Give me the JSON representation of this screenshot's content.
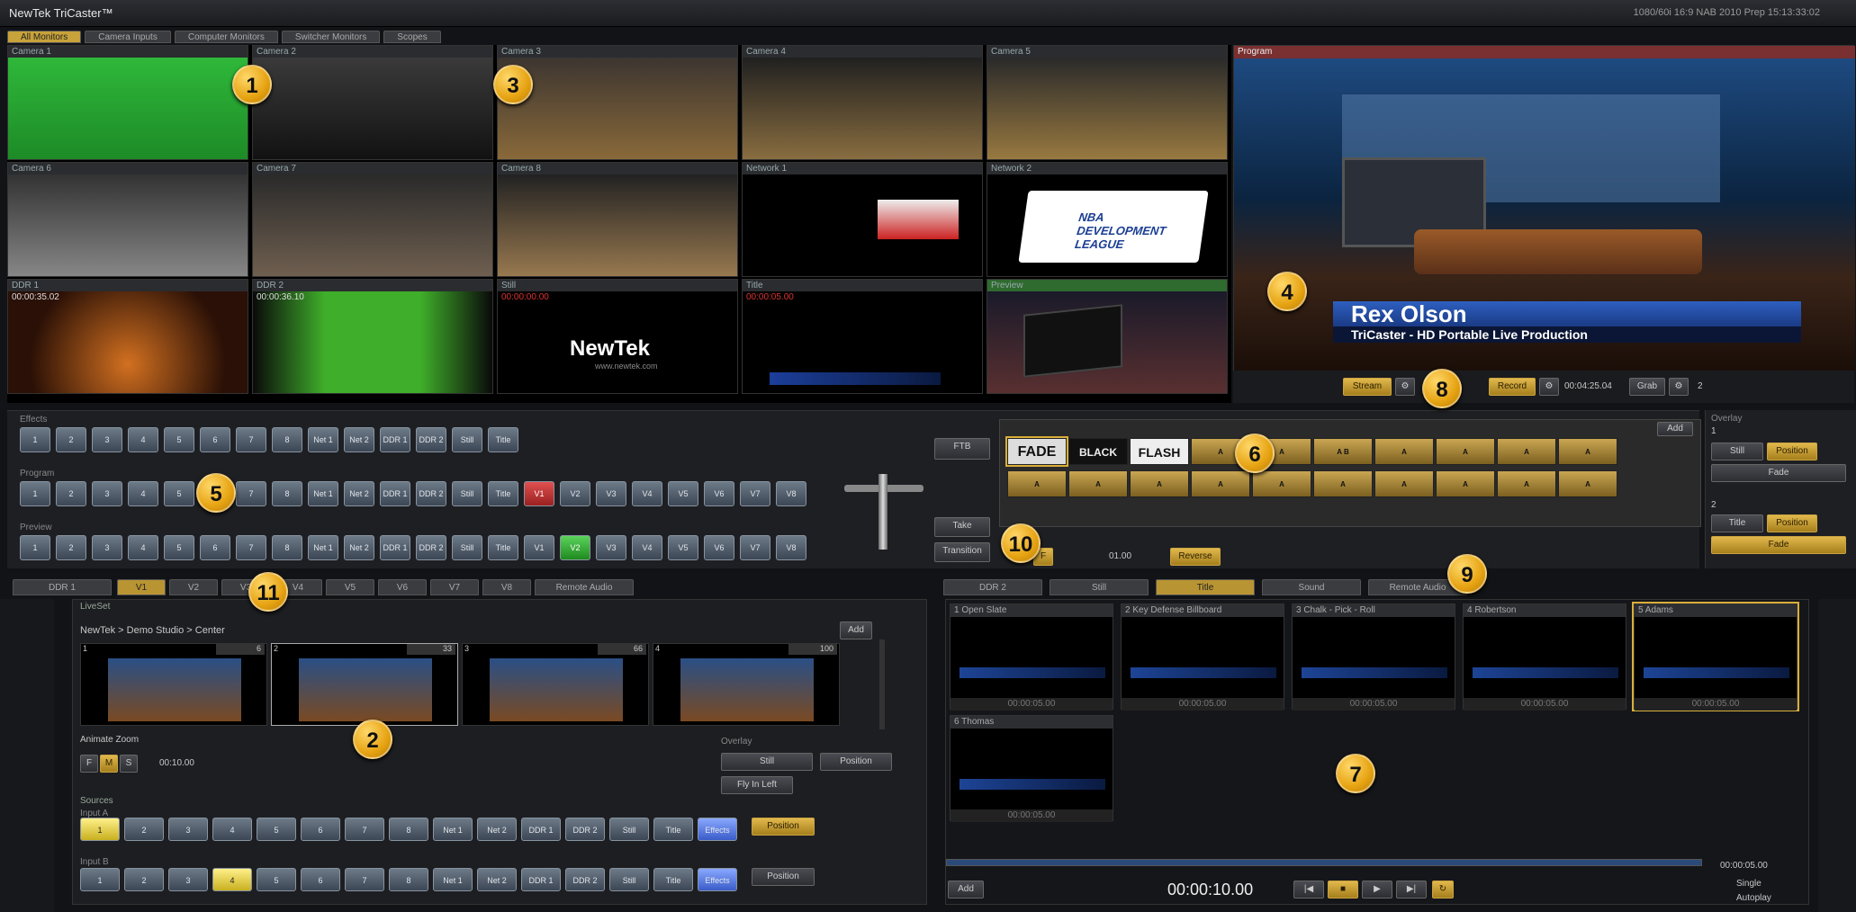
{
  "app": {
    "title": "NewTek TriCaster™",
    "status": "1080/60i 16:9   NAB 2010 Prep   15:13:33:02"
  },
  "monitor_tabs": [
    {
      "label": "All Monitors"
    },
    {
      "label": "Camera Inputs"
    },
    {
      "label": "Computer Monitors"
    },
    {
      "label": "Switcher Monitors"
    },
    {
      "label": "Scopes"
    }
  ],
  "monitors": [
    {
      "label": "Camera 1"
    },
    {
      "label": "Camera 2"
    },
    {
      "label": "Camera 3"
    },
    {
      "label": "Camera 4"
    },
    {
      "label": "Camera 5"
    },
    {
      "label": "Camera 6"
    },
    {
      "label": "Camera 7"
    },
    {
      "label": "Camera 8"
    },
    {
      "label": "Network 1"
    },
    {
      "label": "Network 2"
    },
    {
      "label": "DDR 1",
      "time": "00:00:35.02"
    },
    {
      "label": "DDR 2",
      "time": "00:00:36.10"
    },
    {
      "label": "Still",
      "time": "00:00:00.00"
    },
    {
      "label": "Title",
      "time": "00:00:05.00"
    },
    {
      "label": "Preview"
    }
  ],
  "newtek_logo": "NewTek",
  "newtek_url": "www.newtek.com",
  "nba_text": "NBA DEVELOPMENT LEAGUE",
  "program": {
    "label": "Program",
    "name": "Rex Olson",
    "subtitle": "TriCaster - HD Portable Live Production"
  },
  "record_bar": {
    "stream": "Stream",
    "record": "Record",
    "record_time": "00:04:25.04",
    "grab": "Grab",
    "grab_count": "2"
  },
  "callouts": [
    "1",
    "2",
    "3",
    "4",
    "5",
    "6",
    "7",
    "8",
    "9",
    "10",
    "11"
  ],
  "switcher": {
    "effects_label": "Effects",
    "program_label": "Program",
    "preview_label": "Preview",
    "buttons": [
      "1",
      "2",
      "3",
      "4",
      "5",
      "6",
      "7",
      "8",
      "Net 1",
      "Net 2",
      "DDR 1",
      "DDR 2",
      "Still",
      "Title"
    ],
    "v_buttons": [
      "V1",
      "V2",
      "V3",
      "V4",
      "V5",
      "V6",
      "V7",
      "V8"
    ],
    "ftb": "FTB",
    "take": "Take",
    "transition": "Transition",
    "rate": "01.00",
    "reverse": "Reverse",
    "speed_f": "F"
  },
  "transitions": {
    "add": "Add",
    "tiles": [
      "FADE",
      "BLACK",
      "FLASH",
      "A",
      "A",
      "A B",
      "A",
      "A",
      "A",
      "A",
      "A",
      "A",
      "A",
      "A",
      "A",
      "A",
      "A",
      "A",
      "A",
      "A"
    ]
  },
  "overlay_right": {
    "title": "Overlay",
    "slot1": "1",
    "slot2": "2",
    "still": "Still",
    "title_opt": "Title",
    "position": "Position",
    "fade": "Fade"
  },
  "bottom_tabs": [
    {
      "label": "DDR 1"
    },
    {
      "label": "V1"
    },
    {
      "label": "V2"
    },
    {
      "label": "V3"
    },
    {
      "label": "V4"
    },
    {
      "label": "V5"
    },
    {
      "label": "V6"
    },
    {
      "label": "V7"
    },
    {
      "label": "V8"
    },
    {
      "label": "Remote Audio"
    }
  ],
  "media_tabs": [
    {
      "label": "DDR 2"
    },
    {
      "label": "Still"
    },
    {
      "label": "Title"
    },
    {
      "label": "Sound"
    },
    {
      "label": "Remote Audio"
    }
  ],
  "liveset": {
    "title": "LiveSet",
    "breadcrumb": "NewTek > Demo Studio > Center",
    "add": "Add",
    "presets": [
      {
        "num": "1",
        "val": "6"
      },
      {
        "num": "2",
        "val": "33"
      },
      {
        "num": "3",
        "val": "66"
      },
      {
        "num": "4",
        "val": "100"
      }
    ],
    "animate_zoom": "Animate Zoom",
    "zoom_time": "00:10.00",
    "speeds": [
      "F",
      "M",
      "S"
    ],
    "overlay_label": "Overlay",
    "overlay_still": "Still",
    "overlay_position": "Position",
    "overlay_fly": "Fly In Left",
    "sources": "Sources",
    "input_a": "Input A",
    "input_b": "Input B",
    "position": "Position",
    "src_buttons": [
      "1",
      "2",
      "3",
      "4",
      "5",
      "6",
      "7",
      "8",
      "Net 1",
      "Net 2",
      "DDR 1",
      "DDR 2",
      "Still",
      "Title",
      "Effects"
    ]
  },
  "media": {
    "clips": [
      {
        "title": "1 Open Slate",
        "dur": "00:00:05.00"
      },
      {
        "title": "2 Key Defense Billboard",
        "dur": "00:00:05.00"
      },
      {
        "title": "3 Chalk - Pick - Roll",
        "dur": "00:00:05.00"
      },
      {
        "title": "4 Robertson",
        "dur": "00:00:05.00"
      },
      {
        "title": "5 Adams",
        "dur": "00:00:05.00"
      },
      {
        "title": "6 Thomas",
        "dur": "00:00:05.00"
      }
    ],
    "timecode": "00:00:10.00",
    "end_time": "00:00:05.00",
    "add": "Add",
    "single": "Single",
    "autoplay": "Autoplay"
  }
}
